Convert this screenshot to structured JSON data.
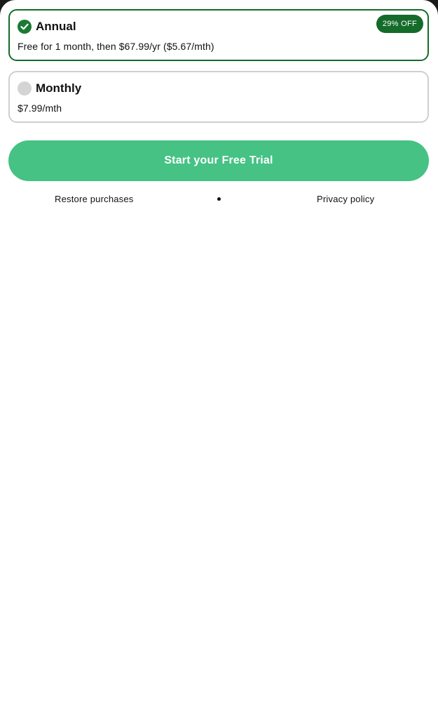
{
  "plans": [
    {
      "id": "annual",
      "title": "Annual",
      "description": "Free for 1 month, then $67.99/yr ($5.67/mth)",
      "badge": "29% OFF",
      "selected": true
    },
    {
      "id": "monthly",
      "title": "Monthly",
      "description": "$7.99/mth",
      "selected": false
    }
  ],
  "cta": {
    "label": "Start your Free Trial"
  },
  "footer": {
    "restore_label": "Restore purchases",
    "privacy_label": "Privacy policy"
  },
  "colors": {
    "accent": "#45c284",
    "selected_border": "#146b2a",
    "badge_bg": "#146b2a",
    "unselected_border": "#cfcfcf",
    "radio_off": "#d4d4d4"
  },
  "icons": {
    "selected_radio": "check-circle-icon",
    "unselected_radio": "empty-radio-icon",
    "separator": "dot"
  }
}
